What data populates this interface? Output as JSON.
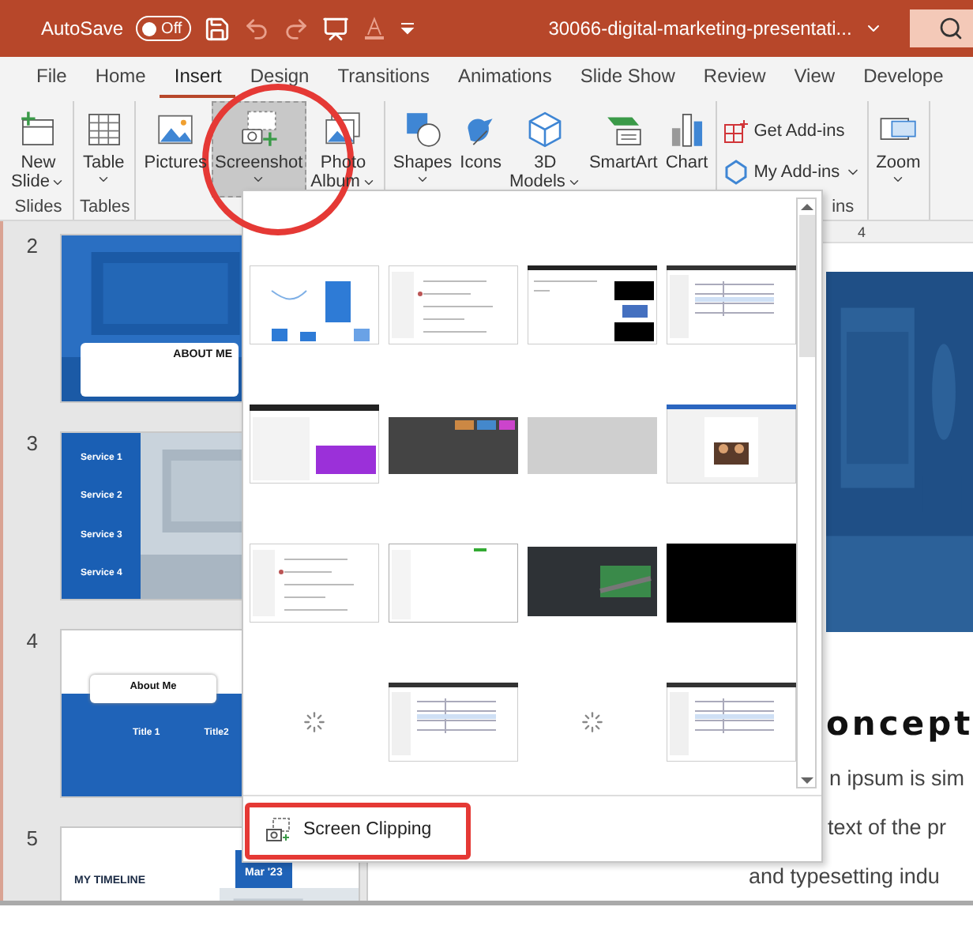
{
  "title_bar": {
    "autosave_label": "AutoSave",
    "autosave_on": false,
    "autosave_state": "Off",
    "document_title": "30066-digital-marketing-presentati..."
  },
  "tabs": [
    {
      "label": "File",
      "selected": false
    },
    {
      "label": "Home",
      "selected": false
    },
    {
      "label": "Insert",
      "selected": true
    },
    {
      "label": "Design",
      "selected": false
    },
    {
      "label": "Transitions",
      "selected": false
    },
    {
      "label": "Animations",
      "selected": false
    },
    {
      "label": "Slide Show",
      "selected": false
    },
    {
      "label": "Review",
      "selected": false
    },
    {
      "label": "View",
      "selected": false
    },
    {
      "label": "Develope",
      "selected": false
    }
  ],
  "ribbon": {
    "groups": [
      {
        "label": "Slides",
        "buttons": [
          {
            "lines": [
              "New",
              "Slide"
            ],
            "dropdown": true,
            "selected": false
          }
        ]
      },
      {
        "label": "Tables",
        "buttons": [
          {
            "lines": [
              "Table"
            ],
            "dropdown": true,
            "selected": false
          }
        ]
      },
      {
        "buttons": [
          {
            "lines": [
              "Pictures"
            ],
            "dropdown": false,
            "selected": false
          },
          {
            "lines": [
              "Screenshot"
            ],
            "dropdown": true,
            "selected": true
          },
          {
            "lines": [
              "Photo",
              "Album"
            ],
            "dropdown": true,
            "selected": false
          }
        ]
      },
      {
        "buttons": [
          {
            "lines": [
              "Shapes"
            ],
            "dropdown": true,
            "selected": false
          },
          {
            "lines": [
              "Icons"
            ],
            "dropdown": false,
            "selected": false
          },
          {
            "lines": [
              "3D",
              "Models"
            ],
            "dropdown": true,
            "selected": false
          },
          {
            "lines": [
              "SmartArt"
            ],
            "dropdown": false,
            "selected": false
          },
          {
            "lines": [
              "Chart"
            ],
            "dropdown": false,
            "selected": false
          }
        ]
      },
      {
        "label": "ins",
        "small_buttons": [
          {
            "label": "Get Add-ins",
            "dropdown": false
          },
          {
            "label": "My Add-ins",
            "dropdown": true
          }
        ]
      },
      {
        "buttons": [
          {
            "lines": [
              "Zoom"
            ],
            "dropdown": true,
            "selected": false
          }
        ]
      }
    ]
  },
  "slides": [
    {
      "number": "2",
      "kind": "about",
      "title": "ABOUT ME"
    },
    {
      "number": "3",
      "kind": "services",
      "items": [
        "Service 1",
        "Service 2",
        "Service 3",
        "Service 4"
      ]
    },
    {
      "number": "4",
      "kind": "titles",
      "title": "About Me",
      "items": [
        "Title 1",
        "Title2"
      ]
    },
    {
      "number": "5",
      "kind": "timeline",
      "title": "MY TIMELINE",
      "tag": "Mar '23"
    }
  ],
  "editor": {
    "ruler_mark": "4",
    "heading": "oncept",
    "lines": [
      "n ipsum is sim",
      "text of the pr",
      "and typesetting indu"
    ]
  },
  "screenshot_menu": {
    "thumbnails": [
      {
        "kind": "chart"
      },
      {
        "kind": "document"
      },
      {
        "kind": "media"
      },
      {
        "kind": "table"
      },
      {
        "kind": "purple"
      },
      {
        "kind": "dark"
      },
      {
        "kind": "gray"
      },
      {
        "kind": "portrait"
      },
      {
        "kind": "document"
      },
      {
        "kind": "blank"
      },
      {
        "kind": "map"
      },
      {
        "kind": "black"
      },
      {
        "kind": "loading"
      },
      {
        "kind": "table"
      },
      {
        "kind": "loading"
      },
      {
        "kind": "table"
      }
    ],
    "clipping_label": "Screen Clipping"
  },
  "annotations": [
    {
      "kind": "circle"
    },
    {
      "kind": "frame"
    }
  ]
}
